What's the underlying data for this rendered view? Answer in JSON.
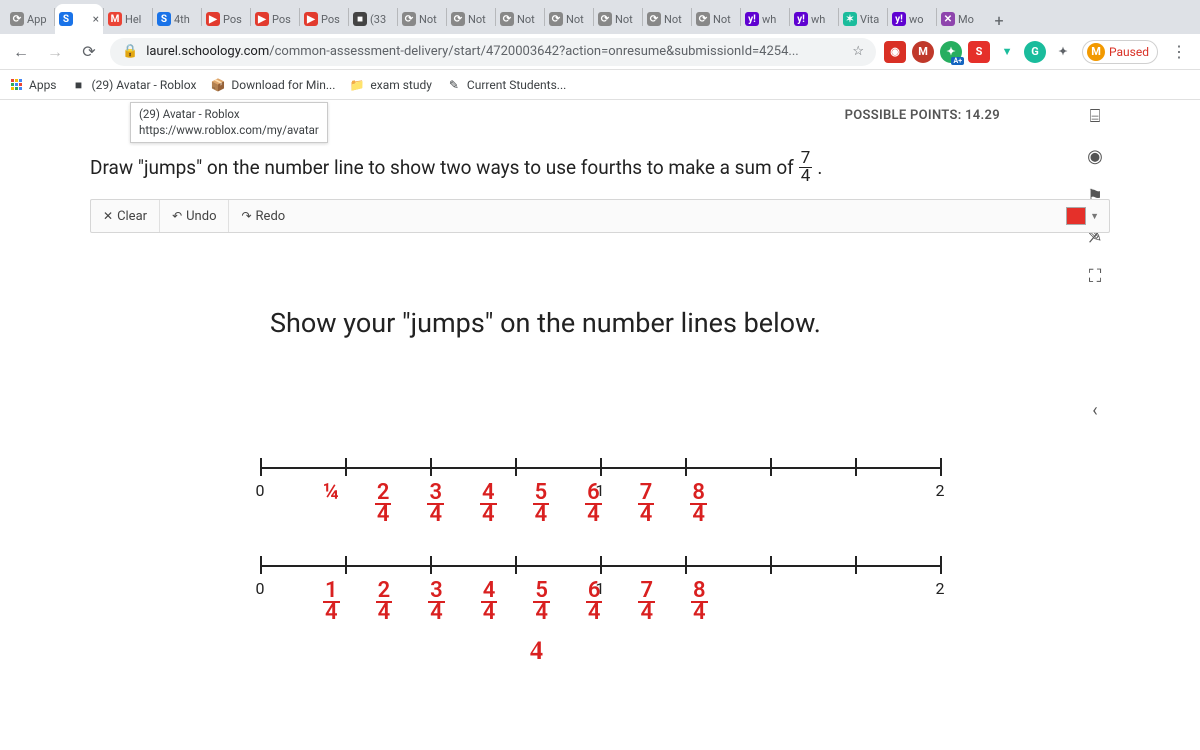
{
  "tabs": [
    {
      "label": "App",
      "fav": "⟳",
      "favbg": "#888"
    },
    {
      "label": "",
      "fav": "S",
      "favbg": "#1a73e8",
      "active": true,
      "closable": true
    },
    {
      "label": "Hel",
      "fav": "M",
      "favbg": "#ea4335"
    },
    {
      "label": "4th",
      "fav": "S",
      "favbg": "#1a73e8"
    },
    {
      "label": "Pos",
      "fav": "▶",
      "favbg": "#e23b2e"
    },
    {
      "label": "Pos",
      "fav": "▶",
      "favbg": "#e23b2e"
    },
    {
      "label": "Pos",
      "fav": "▶",
      "favbg": "#e23b2e"
    },
    {
      "label": "(33",
      "fav": "■",
      "favbg": "#444"
    },
    {
      "label": "Not",
      "fav": "⟳",
      "favbg": "#888"
    },
    {
      "label": "Not",
      "fav": "⟳",
      "favbg": "#888"
    },
    {
      "label": "Not",
      "fav": "⟳",
      "favbg": "#888"
    },
    {
      "label": "Not",
      "fav": "⟳",
      "favbg": "#888"
    },
    {
      "label": "Not",
      "fav": "⟳",
      "favbg": "#888"
    },
    {
      "label": "Not",
      "fav": "⟳",
      "favbg": "#888"
    },
    {
      "label": "Not",
      "fav": "⟳",
      "favbg": "#888"
    },
    {
      "label": "wh",
      "fav": "y!",
      "favbg": "#5f01d1"
    },
    {
      "label": "wh",
      "fav": "y!",
      "favbg": "#5f01d1"
    },
    {
      "label": "Vita",
      "fav": "✶",
      "favbg": "#1abc9c"
    },
    {
      "label": "wo",
      "fav": "y!",
      "favbg": "#5f01d1"
    },
    {
      "label": "Mo",
      "fav": "✕",
      "favbg": "#8e44ad"
    }
  ],
  "url": {
    "lock": "🔒",
    "host": "laurel.schoology.com",
    "path": "/common-assessment-delivery/start/4720003642?action=onresume&submissionId=4254..."
  },
  "paused": "Paused",
  "bookmarks": {
    "apps": "Apps",
    "items": [
      {
        "icon": "■",
        "label": "(29) Avatar - Roblox"
      },
      {
        "icon": "📦",
        "label": "Download for Min..."
      },
      {
        "icon": "📁",
        "label": "exam study"
      },
      {
        "icon": "✎",
        "label": "Current Students..."
      }
    ]
  },
  "tooltip": {
    "title": "(29) Avatar - Roblox",
    "url": "https://www.roblox.com/my/avatar"
  },
  "points_label": "POSSIBLE POINTS: 14.29",
  "prompt_pre": "Draw \"jumps\" on the number line to show two ways to use fourths to make a sum of ",
  "fraction": {
    "num": "7",
    "den": "4"
  },
  "prompt_post": ".",
  "draw": {
    "clear": "Clear",
    "undo": "Undo",
    "redo": "Redo"
  },
  "canvas_heading": "Show your \"jumps\" on the number lines below.",
  "line_ticks": [
    "0",
    "",
    "",
    "",
    "1",
    "",
    "",
    "",
    "2"
  ],
  "hand_row1": [
    "¼",
    "2⁄4",
    "3⁄4",
    "4⁄4",
    "5⁄4",
    "6⁄4",
    "7⁄4",
    "8⁄4"
  ],
  "hand_row2": [
    "1⁄4",
    "2⁄4",
    "3⁄4",
    "4⁄4",
    "5⁄4",
    "6⁄4",
    "7⁄4",
    "8⁄4"
  ],
  "color": "#e5302a"
}
